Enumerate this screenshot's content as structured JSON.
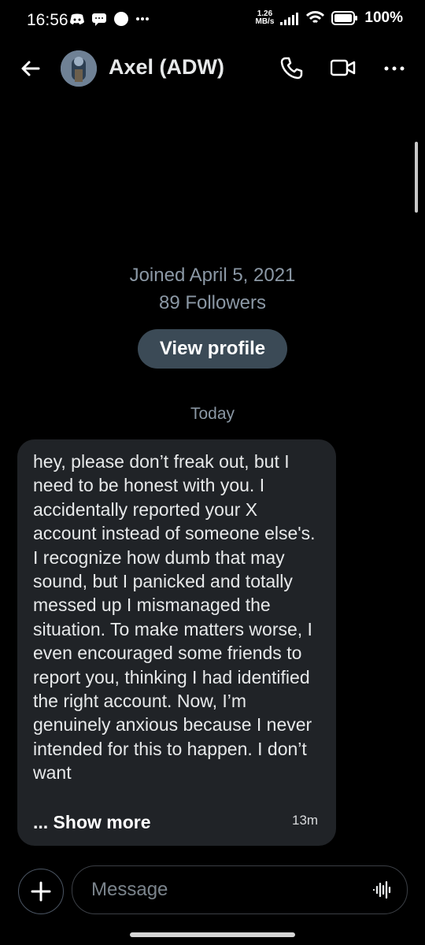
{
  "status_bar": {
    "time": "16:56",
    "network_speed_value": "1.26",
    "network_speed_unit": "MB/s",
    "battery": "100%"
  },
  "header": {
    "contact_name": "Axel (ADW)"
  },
  "profile": {
    "joined": "Joined April 5, 2021",
    "followers": "89 Followers",
    "view_profile_label": "View profile"
  },
  "conversation": {
    "date_label": "Today",
    "messages": [
      {
        "text": "hey, please don’t freak out, but I need to be honest with you. I accidentally reported your X account instead of someone else's. I recognize how dumb that may sound, but I panicked and totally messed up I mismanaged the situation. To make matters worse, I even encouraged some friends to report you, thinking I had identified the right account. Now, I’m genuinely anxious because I never intended for this to happen. I don’t want",
        "show_more_label": "... Show more",
        "timestamp": "13m"
      }
    ]
  },
  "composer": {
    "placeholder": "Message"
  },
  "colors": {
    "background": "#000000",
    "bubble": "#202327",
    "muted_text": "#8b98a5",
    "button": "#3b4a56"
  },
  "icons": [
    "discord-icon",
    "message-icon",
    "circle-icon",
    "signal-icon",
    "wifi-icon",
    "battery-icon",
    "back-arrow-icon",
    "phone-icon",
    "video-icon",
    "more-icon",
    "plus-icon",
    "voice-icon"
  ]
}
